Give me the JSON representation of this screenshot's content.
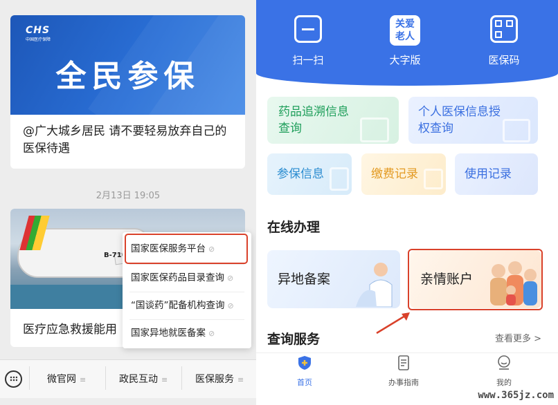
{
  "left": {
    "card1": {
      "logo": "CHS",
      "logo_sub": "中国医疗保障",
      "banner_title": "全民参保",
      "text": "@广大城乡居民 请不要轻易放弃自己的医保待遇"
    },
    "timestamp": "2月13日 19:05",
    "card2": {
      "registration": "B-7168",
      "text": "医疗应急救援能用"
    },
    "popup_menu": [
      {
        "label": "国家医保服务平台",
        "icon": "link-icon"
      },
      {
        "label": "国家医保药品目录查询",
        "icon": "link-icon"
      },
      {
        "label": "“国谈药”配备机构查询",
        "icon": "link-icon"
      },
      {
        "label": "国家异地就医备案",
        "icon": "link-icon"
      }
    ],
    "menu_bar": {
      "keyboard_icon": "keyboard-icon",
      "items": [
        {
          "label": "微官网",
          "icon": "menu-lines-icon"
        },
        {
          "label": "政民互动",
          "icon": "menu-lines-icon"
        },
        {
          "label": "医保服务",
          "icon": "menu-lines-icon"
        }
      ]
    }
  },
  "right": {
    "header": {
      "color": "#3a72e6",
      "items": [
        {
          "label": "扫一扫",
          "icon": "scan-icon"
        },
        {
          "label": "大字版",
          "icon": "elder-icon",
          "icon_text": "关爱\n老人"
        },
        {
          "label": "医保码",
          "icon": "qr-code-icon"
        }
      ]
    },
    "tiles": {
      "trace": "药品追溯信息查询",
      "auth": "个人医保信息授权查询",
      "insure": "参保信息",
      "pay": "缴费记录",
      "use": "使用记录"
    },
    "online_section": {
      "title": "在线办理",
      "remote": "异地备案",
      "family": "亲情账户"
    },
    "query_section": {
      "title": "查询服务",
      "see_more": "查看更多 >"
    },
    "bottom_nav": [
      {
        "label": "首页",
        "icon": "home-shield-icon",
        "active": true
      },
      {
        "label": "办事指南",
        "icon": "document-icon",
        "active": false
      },
      {
        "label": "我的",
        "icon": "profile-icon",
        "active": false
      }
    ],
    "accent_color": "#d9412a"
  },
  "watermark": "www.365jz.com"
}
